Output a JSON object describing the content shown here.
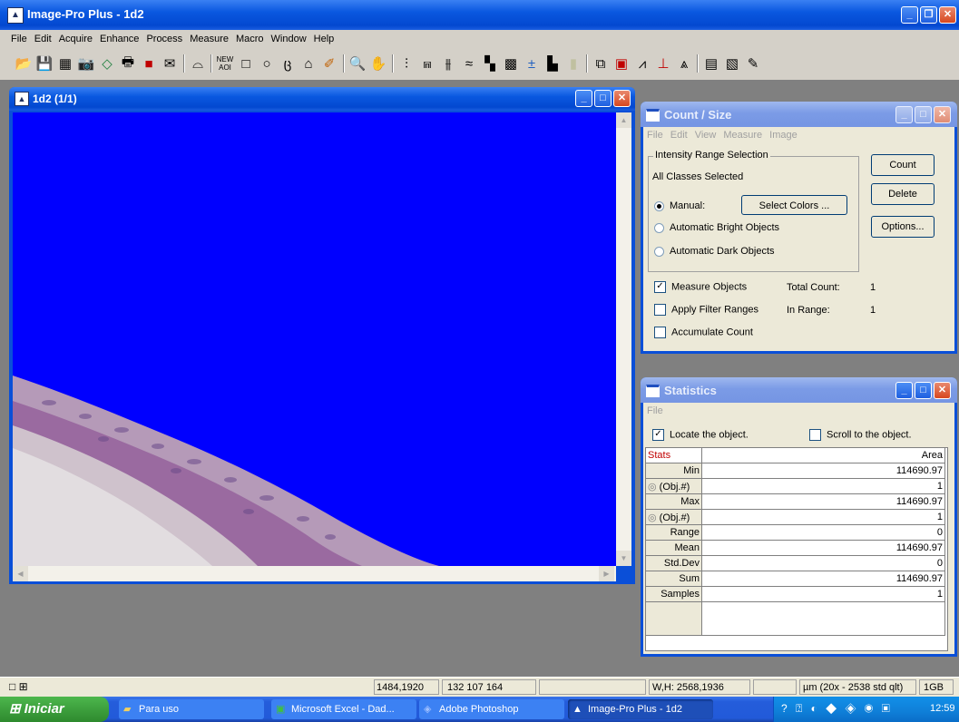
{
  "app": {
    "title": "Image-Pro Plus - 1d2"
  },
  "menu": [
    "File",
    "Edit",
    "Acquire",
    "Enhance",
    "Process",
    "Measure",
    "Macro",
    "Window",
    "Help"
  ],
  "toolbar": {
    "icons": [
      "open",
      "save",
      "grid",
      "camera",
      "lasso",
      "print",
      "stop",
      "envelope",
      "compass",
      "new-aoi",
      "rectangle",
      "ellipse",
      "irregular",
      "polygon",
      "wand",
      "zoom",
      "hand",
      "histogram",
      "line-profile",
      "bars",
      "layers",
      "grid2",
      "grid3",
      "plus-minus",
      "bar-chart",
      "strip",
      "link",
      "colorbar",
      "red-block",
      "histogram2",
      "histogram3",
      "chart",
      "calc",
      "report",
      "pencil"
    ],
    "new_aoi_label": "NEW AOI"
  },
  "image_window": {
    "title": "1d2 (1/1)",
    "bg_color": "#0000ff"
  },
  "count_size": {
    "title": "Count / Size",
    "menu": [
      "File",
      "Edit",
      "View",
      "Measure",
      "Image"
    ],
    "group_title": "Intensity Range Selection",
    "all_classes": "All Classes Selected",
    "manual": "Manual:",
    "select_colors": "Select Colors ...",
    "auto_bright": "Automatic Bright Objects",
    "auto_dark": "Automatic Dark Objects",
    "count_btn": "Count",
    "delete_btn": "Delete",
    "options_btn": "Options...",
    "measure_objects": "Measure Objects",
    "apply_filter": "Apply Filter Ranges",
    "accumulate": "Accumulate Count",
    "total_count_label": "Total Count:",
    "total_count": "1",
    "in_range_label": "In Range:",
    "in_range": "1"
  },
  "statistics": {
    "title": "Statistics",
    "menu": "File",
    "locate": "Locate the object.",
    "scroll": "Scroll to the object.",
    "col_stats": "Stats",
    "col_area": "Area",
    "rows": [
      {
        "label": "Min",
        "value": "114690.97",
        "obj": false
      },
      {
        "label": "(Obj.#)",
        "value": "1",
        "obj": true
      },
      {
        "label": "Max",
        "value": "114690.97",
        "obj": false
      },
      {
        "label": "(Obj.#)",
        "value": "1",
        "obj": true
      },
      {
        "label": "Range",
        "value": "0",
        "obj": false
      },
      {
        "label": "Mean",
        "value": "114690.97",
        "obj": false
      },
      {
        "label": "Std.Dev",
        "value": "0",
        "obj": false
      },
      {
        "label": "Sum",
        "value": "114690.97",
        "obj": false
      },
      {
        "label": "Samples",
        "value": "1",
        "obj": false
      }
    ]
  },
  "status": {
    "coords": "1484,1920",
    "value": "132 107 164",
    "wh": "W,H: 2568,1936",
    "calib": "µm (20x - 2538 std qlt)",
    "mem": "1GB"
  },
  "taskbar": {
    "start": "Iniciar",
    "items": [
      "Para uso",
      "Microsoft Excel - Dad...",
      "Adobe Photoshop",
      "Image-Pro Plus - 1d2"
    ],
    "clock": "12:59"
  }
}
